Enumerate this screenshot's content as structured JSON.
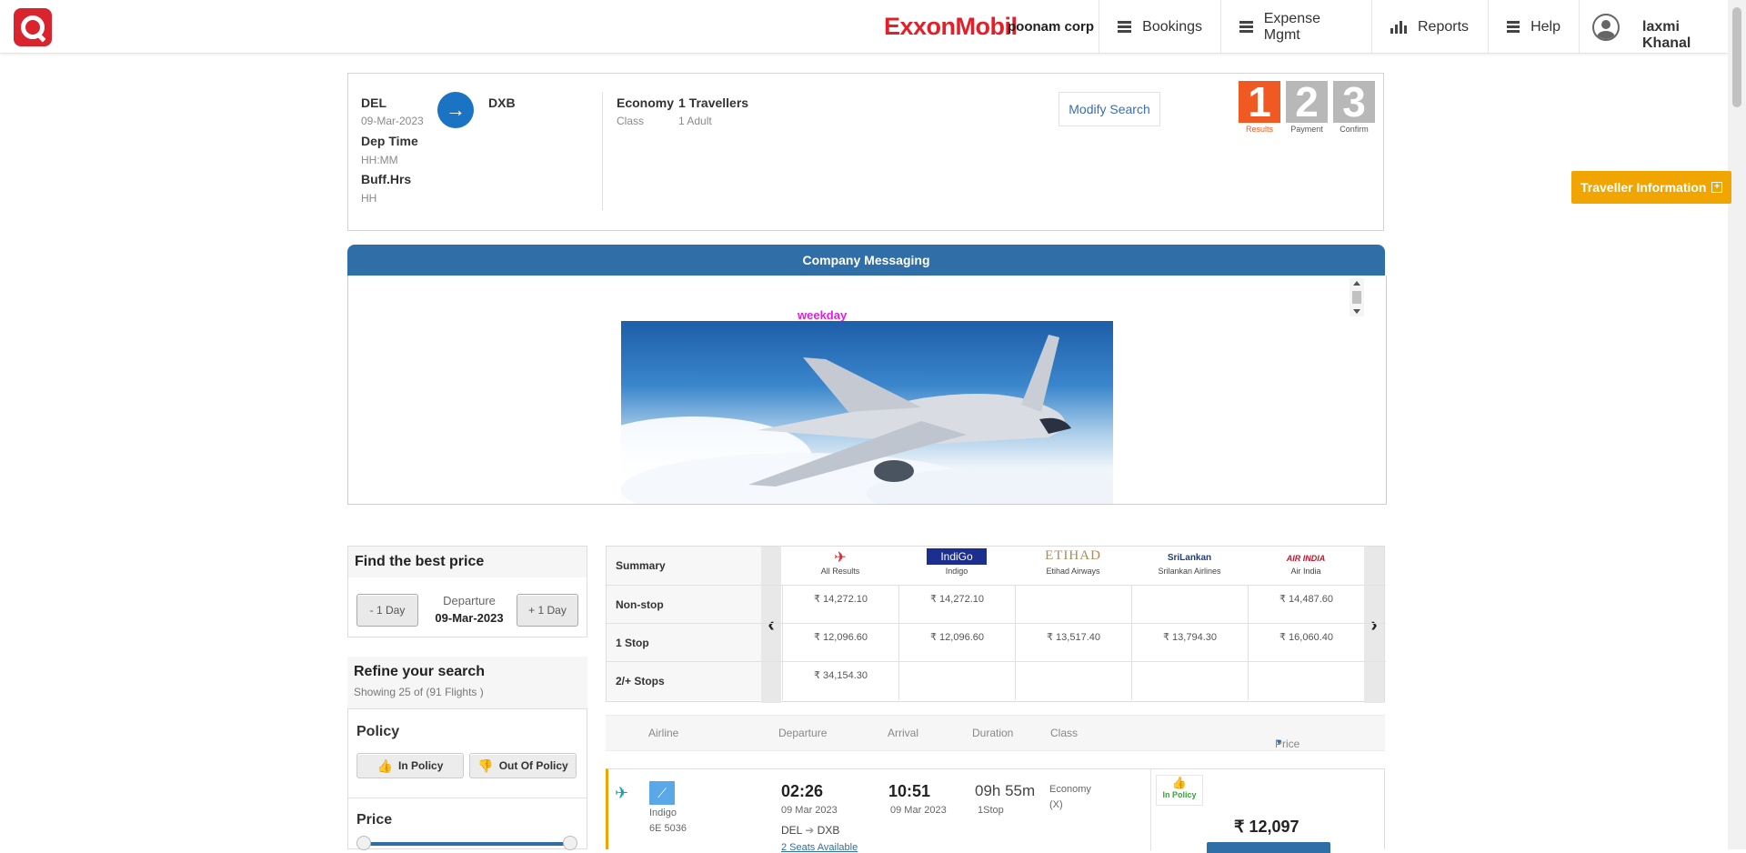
{
  "header": {
    "brand": "ExxonMobil",
    "company": "poonam corp",
    "nav": [
      {
        "label": "Bookings"
      },
      {
        "label": "Expense Mgmt"
      },
      {
        "label": "Reports"
      },
      {
        "label": "Help"
      }
    ],
    "user": "laxmi Khanal"
  },
  "search": {
    "origin": "DEL",
    "destination": "DXB",
    "date": "09-Mar-2023",
    "dep_time_label": "Dep Time",
    "dep_time_placeholder": "HH:MM",
    "buff_label": "Buff.Hrs",
    "buff_placeholder": "HH",
    "class_value": "Economy",
    "class_label": "Class",
    "travellers_value": "1 Travellers",
    "travellers_sub": "1 Adult",
    "modify_label": "Modify Search"
  },
  "steps": [
    {
      "num": "1",
      "label": "Results",
      "color": "#f05a22"
    },
    {
      "num": "2",
      "label": "Payment",
      "color": "#b8b8b8"
    },
    {
      "num": "3",
      "label": "Confirm",
      "color": "#b8b8b8"
    }
  ],
  "traveller_info": "Traveller Information",
  "messaging": {
    "title": "Company Messaging",
    "weekday": "weekday"
  },
  "best_price": {
    "title": "Find the best price",
    "minus": "- 1 Day",
    "plus": "+ 1 Day",
    "label": "Departure",
    "date": "09-Mar-2023"
  },
  "refine": {
    "title": "Refine your search",
    "showing": "Showing 25 of (91 Flights )",
    "policy_title": "Policy",
    "in_policy": "In Policy",
    "out_policy": "Out Of Policy",
    "price_title": "Price"
  },
  "matrix": {
    "header_label": "Summary",
    "airlines": [
      {
        "name": "All Results",
        "logo": "plane-icon"
      },
      {
        "name": "Indigo",
        "logo": "IndiGo"
      },
      {
        "name": "Etihad Airways",
        "logo": "ETIHAD"
      },
      {
        "name": "Srilankan Airlines",
        "logo": "SriLankan"
      },
      {
        "name": "Air India",
        "logo": "AIR INDIA"
      }
    ],
    "rows": [
      {
        "label": "Non-stop",
        "values": [
          "₹ 14,272.10",
          "₹ 14,272.10",
          "",
          "",
          "₹ 14,487.60"
        ]
      },
      {
        "label": "1 Stop",
        "values": [
          "₹ 12,096.60",
          "₹ 12,096.60",
          "₹ 13,517.40",
          "₹ 13,794.30",
          "₹ 16,060.40"
        ]
      },
      {
        "label": "2/+ Stops",
        "values": [
          "₹ 34,154.30",
          "",
          "",
          "",
          ""
        ]
      }
    ]
  },
  "results_header": {
    "airline": "Airline",
    "departure": "Departure",
    "arrival": "Arrival",
    "duration": "Duration",
    "class": "Class",
    "price": "Price"
  },
  "result": {
    "airline": "Indigo",
    "flight": "6E  5036",
    "dep_time": "02:26",
    "dep_date": "09 Mar 2023",
    "route_from": "DEL",
    "route_to": "DXB",
    "seats": "2 Seats Available",
    "arr_time": "10:51",
    "arr_date": "09 Mar 2023",
    "duration": "09h 55m",
    "stops": "1Stop",
    "class": "Economy",
    "class_code": "(X)",
    "policy": "In Policy",
    "price": "₹ 12,097"
  }
}
